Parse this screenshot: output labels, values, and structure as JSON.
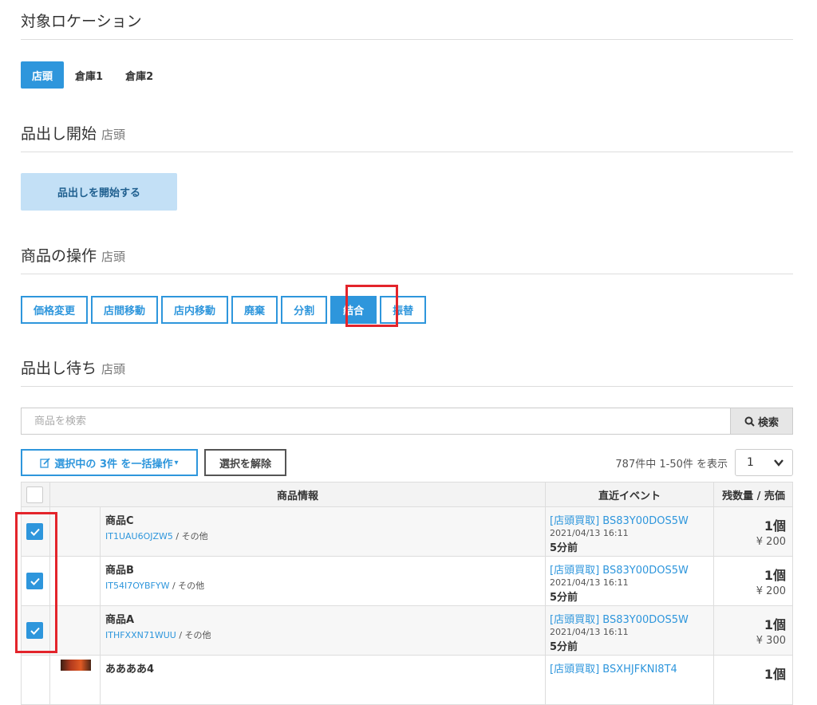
{
  "colors": {
    "primary": "#2e96dc",
    "highlight": "#e3242b",
    "start_button_bg": "#c3e0f6"
  },
  "location_section": {
    "title": "対象ロケーション"
  },
  "location_tabs": [
    {
      "label": "店頭",
      "active": true
    },
    {
      "label": "倉庫1",
      "active": false
    },
    {
      "label": "倉庫2",
      "active": false
    }
  ],
  "start_section": {
    "title": "品出し開始",
    "sub": "店頭",
    "button_label": "品出しを開始する"
  },
  "operations_section": {
    "title": "商品の操作",
    "sub": "店頭"
  },
  "operations": [
    {
      "label": "価格変更",
      "active": false
    },
    {
      "label": "店間移動",
      "active": false
    },
    {
      "label": "店内移動",
      "active": false
    },
    {
      "label": "廃棄",
      "active": false
    },
    {
      "label": "分割",
      "active": false
    },
    {
      "label": "結合",
      "active": true
    },
    {
      "label": "振替",
      "active": false
    }
  ],
  "waiting_section": {
    "title": "品出し待ち",
    "sub": "店頭"
  },
  "search": {
    "placeholder": "商品を検索",
    "button_label": "検索",
    "icon": "search-icon"
  },
  "bulk": {
    "button_label": "選択中の 3件 を一括操作",
    "icon": "edit-icon",
    "caret": "▾",
    "deselect_label": "選択を解除"
  },
  "pagination": {
    "count_text": "787件中 1-50件 を表示",
    "per_page": "1"
  },
  "table": {
    "headers": {
      "product": "商品情報",
      "event": "直近イベント",
      "qty_price": "残数量 / 売価"
    },
    "rows": [
      {
        "checked": true,
        "name": "商品C",
        "code": "IT1UAU6OJZW5",
        "category": " / その他",
        "event_link": "[店頭買取] BS83Y00DOS5W",
        "event_date": "2021/04/13 16:11",
        "event_ago": "5分前",
        "qty": "1個",
        "price": "¥ 200"
      },
      {
        "checked": true,
        "name": "商品B",
        "code": "IT54I7OYBFYW",
        "category": " / その他",
        "event_link": "[店頭買取] BS83Y00DOS5W",
        "event_date": "2021/04/13 16:11",
        "event_ago": "5分前",
        "qty": "1個",
        "price": "¥ 200"
      },
      {
        "checked": true,
        "name": "商品A",
        "code": "ITHFXXN71WUU",
        "category": " / その他",
        "event_link": "[店頭買取] BS83Y00DOS5W",
        "event_date": "2021/04/13 16:11",
        "event_ago": "5分前",
        "qty": "1個",
        "price": "¥ 300"
      },
      {
        "checked": false,
        "name": "ああああ4",
        "code": "",
        "category": "",
        "event_link": "[店頭買取] BSXHJFKNI8T4",
        "event_date": "",
        "event_ago": "",
        "qty": "1個",
        "price": ""
      }
    ]
  }
}
